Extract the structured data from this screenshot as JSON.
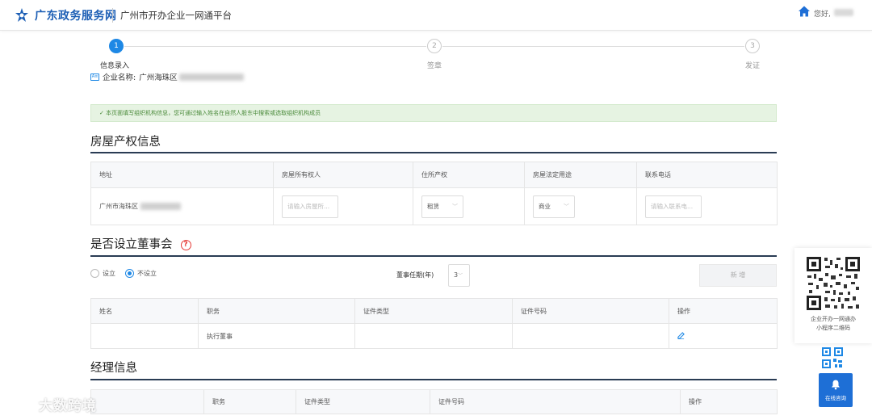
{
  "header": {
    "site_name": "广东政务服务网",
    "platform_name": "广州市开办企业一网通平台",
    "greeting": "您好,"
  },
  "steps": [
    {
      "num": "1",
      "label": "信息录入",
      "active": true
    },
    {
      "num": "2",
      "label": "签章",
      "active": false
    },
    {
      "num": "3",
      "label": "发证",
      "active": false
    }
  ],
  "company": {
    "label": "企业名称:",
    "value": "广州海珠区"
  },
  "notice": "✓ 本页面填写组织机构信息，您可通过输入姓名在自然人股东中搜索或选取组织机构成员",
  "property": {
    "title": "房屋产权信息",
    "headers": [
      "地址",
      "房屋所有权人",
      "住所产权",
      "房屋法定用途",
      "联系电话"
    ],
    "address": "广州市海珠区",
    "owner_placeholder": "请输入房屋所...",
    "ownership_value": "租赁",
    "usage_value": "商业",
    "phone_placeholder": "请输入联系电..."
  },
  "board": {
    "title": "是否设立董事会",
    "help_icon": "question-circle-icon",
    "radio_yes": "设立",
    "radio_no": "不设立",
    "selected": "不设立",
    "term_label": "董事任期(年)",
    "term_value": "3",
    "add_button": "新 增",
    "headers": [
      "姓名",
      "职务",
      "证件类型",
      "证件号码",
      "操作"
    ],
    "rows": [
      {
        "name": "",
        "position": "执行董事",
        "id_type": "",
        "id_number": ""
      }
    ]
  },
  "manager": {
    "title": "经理信息",
    "headers": [
      "职务",
      "证件类型",
      "证件号码",
      "操作"
    ]
  },
  "side": {
    "qr_caption_1": "企业开办一网通办",
    "qr_caption_2": "小程序二维码",
    "chat_label": "在线咨询"
  },
  "watermark": "大数跨境",
  "colors": {
    "primary": "#1e88e5",
    "brand": "#1d5fb5",
    "notice_bg": "#e6f3e2",
    "danger": "#e53935"
  }
}
